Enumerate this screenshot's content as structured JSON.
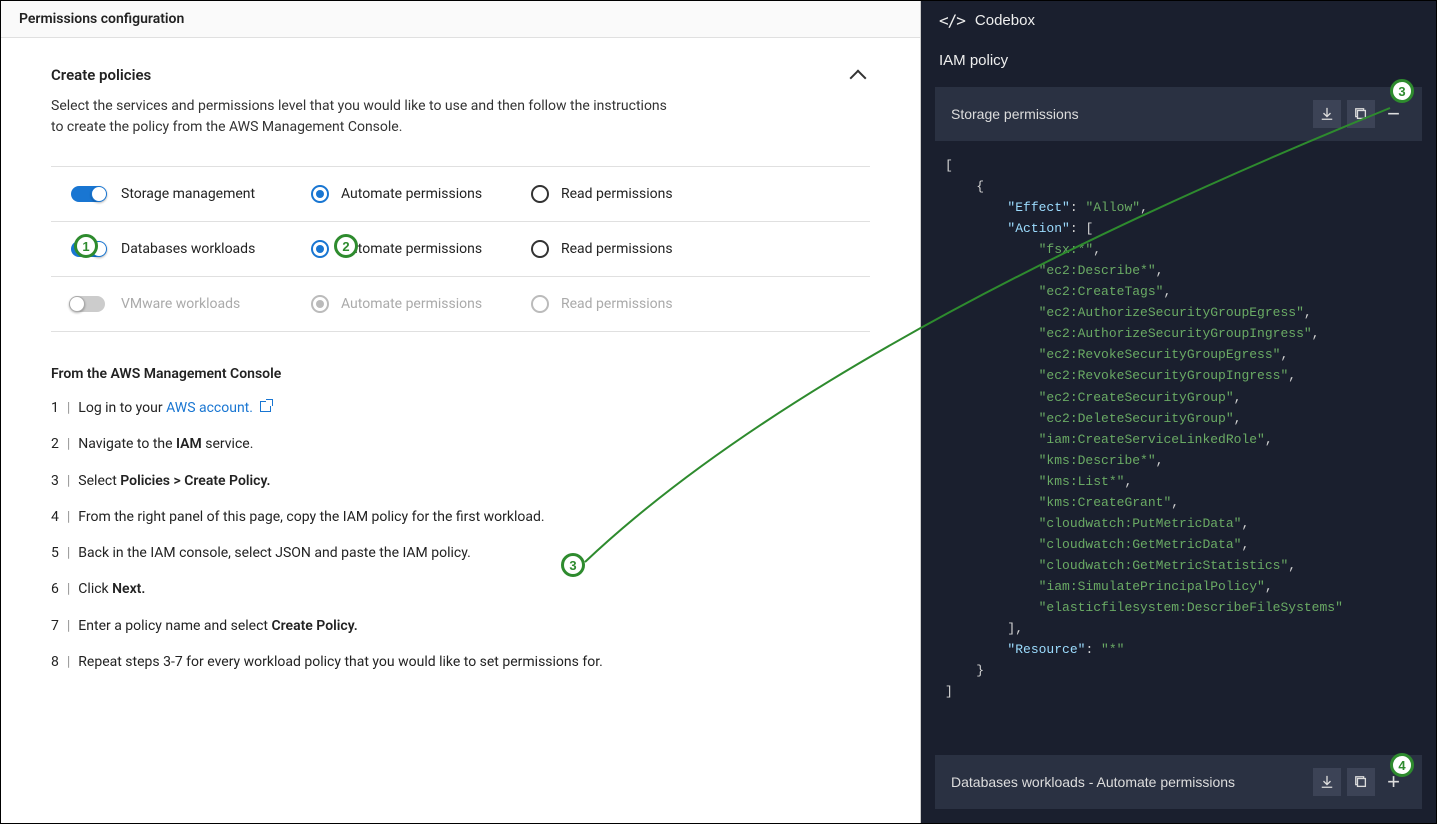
{
  "header": {
    "title": "Permissions configuration"
  },
  "create_policies": {
    "title": "Create policies",
    "description_line1": "Select the services and permissions level that you would like to use and then follow the instructions",
    "description_line2": "to create the policy from the AWS Management Console."
  },
  "services": [
    {
      "name": "Storage management",
      "enabled": true,
      "automate": "Automate permissions",
      "read": "Read permissions"
    },
    {
      "name": "Databases workloads",
      "enabled": true,
      "automate": "Automate permissions",
      "read": "Read permissions"
    },
    {
      "name": "VMware workloads",
      "enabled": false,
      "automate": "Automate permissions",
      "read": "Read permissions"
    }
  ],
  "instructions_header": "From the AWS Management Console",
  "steps": {
    "s1_pre": "Log in to your ",
    "s1_link": "AWS account.",
    "s2_pre": "Navigate to the ",
    "s2_bold": "IAM",
    "s2_post": " service.",
    "s3_pre": "Select ",
    "s3_bold": "Policies > Create Policy.",
    "s4": "From the right panel of this page, copy the IAM policy for the first workload.",
    "s5": "Back in the IAM console, select JSON and paste the IAM policy.",
    "s6_pre": "Click ",
    "s6_bold": "Next.",
    "s7_pre": "Enter a policy name and select ",
    "s7_bold": "Create Policy.",
    "s8": "Repeat steps 3-7 for every workload policy that you would like to set permissions for."
  },
  "codebox": {
    "title": "Codebox",
    "subtitle": "IAM policy",
    "storage_bar": "Storage permissions",
    "db_bar": "Databases workloads - Automate permissions",
    "policy": {
      "effect_key": "\"Effect\"",
      "effect_val": "\"Allow\"",
      "action_key": "\"Action\"",
      "actions": [
        "\"fsx:*\"",
        "\"ec2:Describe*\"",
        "\"ec2:CreateTags\"",
        "\"ec2:AuthorizeSecurityGroupEgress\"",
        "\"ec2:AuthorizeSecurityGroupIngress\"",
        "\"ec2:RevokeSecurityGroupEgress\"",
        "\"ec2:RevokeSecurityGroupIngress\"",
        "\"ec2:CreateSecurityGroup\"",
        "\"ec2:DeleteSecurityGroup\"",
        "\"iam:CreateServiceLinkedRole\"",
        "\"kms:Describe*\"",
        "\"kms:List*\"",
        "\"kms:CreateGrant\"",
        "\"cloudwatch:PutMetricData\"",
        "\"cloudwatch:GetMetricData\"",
        "\"cloudwatch:GetMetricStatistics\"",
        "\"iam:SimulatePrincipalPolicy\"",
        "\"elasticfilesystem:DescribeFileSystems\""
      ],
      "resource_key": "\"Resource\"",
      "resource_val": "\"*\""
    }
  },
  "callouts": {
    "c1": "1",
    "c2": "2",
    "c3": "3",
    "c3b": "3",
    "c4": "4"
  }
}
